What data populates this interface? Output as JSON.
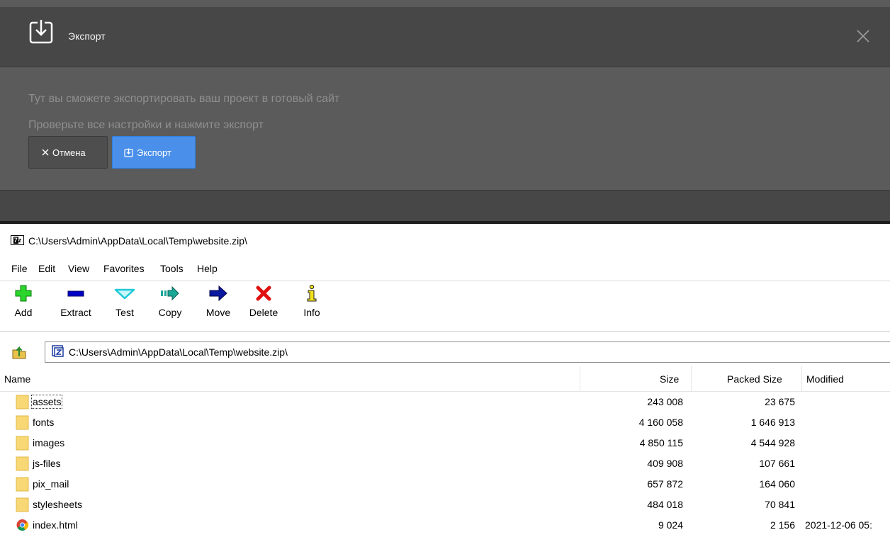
{
  "dialog": {
    "title": "Экспорт",
    "line1": "Тут вы сможете экспортировать ваш проект в готовый сайт",
    "line2": "Проверьте все настройки и нажмите экспорт",
    "cancel_label": "Отмена",
    "export_label": "Экспорт",
    "colors": {
      "header": "#474747",
      "body": "#5b5b5b",
      "export_button": "#4a90ea",
      "muted_text": "#8f8f8f"
    },
    "icons": {
      "header": "export-icon",
      "close": "close-icon",
      "cancel": "close-icon",
      "export": "export-icon"
    }
  },
  "zip": {
    "title": "C:\\Users\\Admin\\AppData\\Local\\Temp\\website.zip\\",
    "menu": [
      "File",
      "Edit",
      "View",
      "Favorites",
      "Tools",
      "Help"
    ],
    "toolbar": [
      {
        "label": "Add",
        "icon": "add-icon",
        "color": "#2bd52b"
      },
      {
        "label": "Extract",
        "icon": "extract-icon",
        "color": "#0000c8"
      },
      {
        "label": "Test",
        "icon": "test-icon",
        "color": "#1ec8d8"
      },
      {
        "label": "Copy",
        "icon": "copy-icon",
        "color": "#1aa898"
      },
      {
        "label": "Move",
        "icon": "move-icon",
        "color": "#0a1aa0"
      },
      {
        "label": "Delete",
        "icon": "delete-icon",
        "color": "#e01010"
      },
      {
        "label": "Info",
        "icon": "info-icon",
        "color": "#f2e11b"
      }
    ],
    "address": "C:\\Users\\Admin\\AppData\\Local\\Temp\\website.zip\\",
    "columns": {
      "name": "Name",
      "size": "Size",
      "packed": "Packed Size",
      "modified": "Modified"
    },
    "files": [
      {
        "name": "assets",
        "type": "folder",
        "size": "243 008",
        "packed": "23 675",
        "modified": ""
      },
      {
        "name": "fonts",
        "type": "folder",
        "size": "4 160 058",
        "packed": "1 646 913",
        "modified": ""
      },
      {
        "name": "images",
        "type": "folder",
        "size": "4 850 115",
        "packed": "4 544 928",
        "modified": ""
      },
      {
        "name": "js-files",
        "type": "folder",
        "size": "409 908",
        "packed": "107 661",
        "modified": ""
      },
      {
        "name": "pix_mail",
        "type": "folder",
        "size": "657 872",
        "packed": "164 060",
        "modified": ""
      },
      {
        "name": "stylesheets",
        "type": "folder",
        "size": "484 018",
        "packed": "70 841",
        "modified": ""
      },
      {
        "name": "index.html",
        "type": "html",
        "size": "9 024",
        "packed": "2 156",
        "modified": "2021-12-06 05:"
      }
    ]
  }
}
